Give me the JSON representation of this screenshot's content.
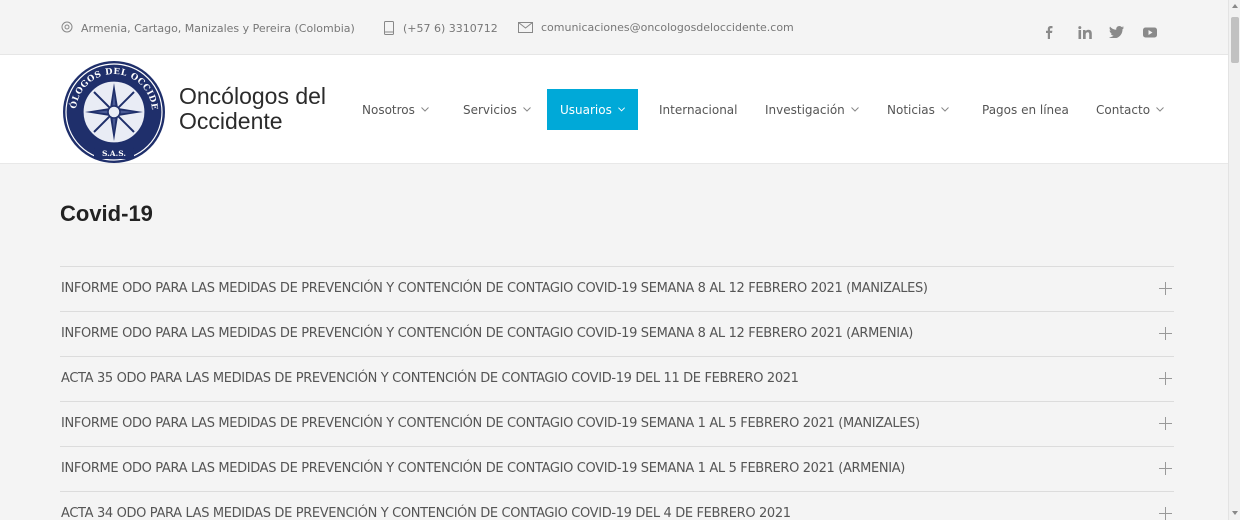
{
  "topbar": {
    "location": "Armenia, Cartago, Manizales y Pereira (Colombia)",
    "phone": "(+57 6) 3310712",
    "email": "comunicaciones@oncologosdeloccidente.com",
    "social": [
      "facebook-icon",
      "linkedin-icon",
      "twitter-icon",
      "youtube-icon"
    ]
  },
  "header": {
    "brand_line1": "Oncólogos del",
    "brand_line2": "Occidente",
    "logo_text_top": "ONCÓLOGOS DEL OCCIDENTE",
    "logo_text_bottom": "S.A.S.",
    "nav": [
      {
        "label": "Nosotros",
        "dropdown": true
      },
      {
        "label": "Servicios",
        "dropdown": true
      },
      {
        "label": "Usuarios",
        "dropdown": true,
        "active": true
      },
      {
        "label": "Internacional",
        "dropdown": false
      },
      {
        "label": "Investigación",
        "dropdown": true
      },
      {
        "label": "Noticias",
        "dropdown": true
      },
      {
        "label": "Pagos en línea",
        "dropdown": false
      },
      {
        "label": "Contacto",
        "dropdown": true
      }
    ]
  },
  "main": {
    "title": "Covid-19",
    "items": [
      "INFORME ODO PARA LAS MEDIDAS DE PREVENCIÓN Y CONTENCIÓN DE CONTAGIO COVID-19 SEMANA 8 AL 12 FEBRERO 2021 (MANIZALES)",
      "INFORME ODO PARA LAS MEDIDAS DE PREVENCIÓN Y CONTENCIÓN DE CONTAGIO COVID-19 SEMANA 8 AL 12 FEBRERO 2021 (ARMENIA)",
      "ACTA 35 ODO PARA LAS MEDIDAS DE PREVENCIÓN Y CONTENCIÓN DE CONTAGIO COVID-19 DEL 11 DE FEBRERO 2021",
      "INFORME ODO PARA LAS MEDIDAS DE PREVENCIÓN Y CONTENCIÓN DE CONTAGIO COVID-19 SEMANA 1 AL 5 FEBRERO 2021 (MANIZALES)",
      "INFORME ODO PARA LAS MEDIDAS DE PREVENCIÓN Y CONTENCIÓN DE CONTAGIO COVID-19 SEMANA 1 AL 5 FEBRERO 2021 (ARMENIA)",
      "ACTA 34 ODO PARA LAS MEDIDAS DE PREVENCIÓN Y CONTENCIÓN DE CONTAGIO COVID-19 DEL 4 DE FEBRERO 2021"
    ]
  },
  "colors": {
    "accent": "#00a9d8",
    "logo_navy": "#1f2f6b"
  }
}
